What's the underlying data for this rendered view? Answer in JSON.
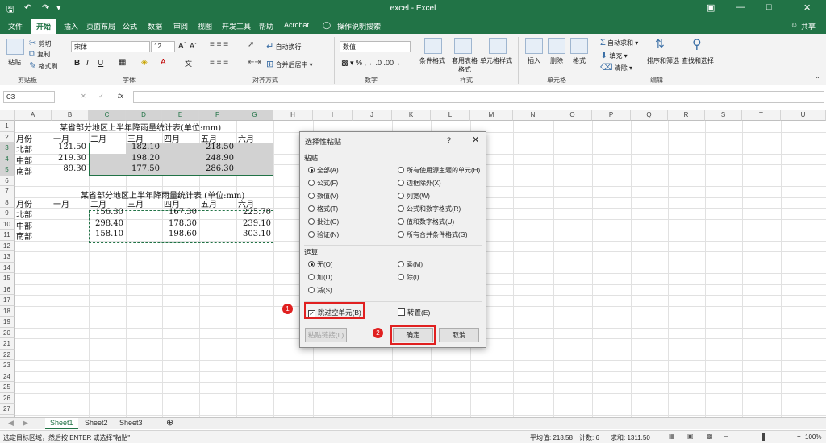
{
  "titlebar": {
    "title": "excel - Excel"
  },
  "tabs": [
    "文件",
    "开始",
    "插入",
    "页面布局",
    "公式",
    "数据",
    "审阅",
    "视图",
    "开发工具",
    "帮助",
    "Acrobat"
  ],
  "tell_me": "操作说明搜索",
  "share": "共享",
  "ribbon": {
    "clipboard": {
      "paste": "粘贴",
      "cut": "剪切",
      "copy": "复制",
      "painter": "格式刷",
      "label": "剪贴板"
    },
    "font": {
      "name": "宋体",
      "size": "12",
      "label": "字体"
    },
    "align": {
      "wrap": "自动换行",
      "merge": "合并后居中",
      "label": "对齐方式"
    },
    "number": {
      "format": "数值",
      "label": "数字"
    },
    "styles": {
      "cond": "条件格式",
      "table": "套用表格格式",
      "cell": "单元格样式",
      "label": "样式"
    },
    "cells": {
      "insert": "插入",
      "delete": "删除",
      "format": "格式",
      "label": "单元格"
    },
    "editing": {
      "autosum": "自动求和",
      "fill": "填充",
      "clear": "清除",
      "sort": "排序和筛选",
      "find": "查找和选择",
      "label": "编辑"
    }
  },
  "namebox": "C3",
  "fx": "fx",
  "columns": [
    "A",
    "B",
    "C",
    "D",
    "E",
    "F",
    "G",
    "H",
    "I",
    "J",
    "K",
    "L",
    "M",
    "N",
    "O",
    "P",
    "Q",
    "R",
    "S",
    "T",
    "U"
  ],
  "rows": [
    "1",
    "2",
    "3",
    "4",
    "5",
    "6",
    "7",
    "8",
    "9",
    "10",
    "11",
    "12",
    "13",
    "14",
    "15",
    "16",
    "17",
    "18",
    "19",
    "20",
    "21",
    "22",
    "23",
    "24",
    "25",
    "26",
    "27",
    "28"
  ],
  "sheet": {
    "title1": "某省部分地区上半年降雨量统计表(单位:mm)",
    "title2": "某省部分地区上半年降雨量统计表 (单位:mm)",
    "header1": [
      "月份",
      "一月",
      "二月",
      "三月",
      "四月",
      "五月",
      "六月"
    ],
    "rows1": [
      [
        "北部",
        "121.50",
        "",
        "182.10",
        "",
        "218.50",
        ""
      ],
      [
        "中部",
        "219.30",
        "",
        "198.20",
        "",
        "248.90",
        ""
      ],
      [
        "南部",
        "89.30",
        "",
        "177.50",
        "",
        "286.30",
        ""
      ]
    ],
    "header2": [
      "月份",
      "一月",
      "二月",
      "三月",
      "四月",
      "五月",
      "六月"
    ],
    "rows2": [
      [
        "北部",
        "",
        "156.30",
        "",
        "167.30",
        "",
        "225.70"
      ],
      [
        "中部",
        "",
        "298.40",
        "",
        "178.30",
        "",
        "239.10"
      ],
      [
        "南部",
        "",
        "158.10",
        "",
        "198.60",
        "",
        "303.10"
      ]
    ]
  },
  "sheets": [
    "Sheet1",
    "Sheet2",
    "Sheet3"
  ],
  "status": {
    "msg": "选定目标区域，然后按 ENTER 或选择\"粘贴\"",
    "avg": "平均值: 218.58",
    "count": "计数: 6",
    "sum": "求和: 1311.50",
    "zoom": "100%"
  },
  "dialog": {
    "title": "选择性粘贴",
    "help": "?",
    "paste_label": "粘贴",
    "paste_left": [
      "全部(A)",
      "公式(F)",
      "数值(V)",
      "格式(T)",
      "批注(C)",
      "验证(N)"
    ],
    "paste_right": [
      "所有使用源主题的单元(H)",
      "边框除外(X)",
      "列宽(W)",
      "公式和数字格式(R)",
      "值和数字格式(U)",
      "所有合并条件格式(G)"
    ],
    "op_label": "运算",
    "op_left": [
      "无(O)",
      "加(D)",
      "减(S)"
    ],
    "op_right": [
      "乘(M)",
      "除(I)"
    ],
    "skip_blanks": "跳过空单元(B)",
    "transpose": "转置(E)",
    "paste_link": "粘贴链接(L)",
    "ok": "确定",
    "cancel": "取消",
    "badge1": "1",
    "badge2": "2"
  }
}
